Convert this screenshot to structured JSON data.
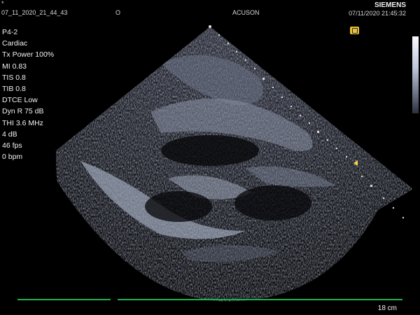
{
  "header": {
    "asterisk": "*",
    "exam_id": "07_11_2020_21_44_43",
    "orientation_marker": "O",
    "manufacturer": "ACUSON",
    "brand": "SIEMENS",
    "datetime": "07/11/2020 21:45:32"
  },
  "params": {
    "probe": "P4-2",
    "preset": "Cardiac",
    "tx_power": "Tx Power 100%",
    "mi": "MI 0.83",
    "tis": "TIS 0.8",
    "tib": "TIB 0.8",
    "dtce": "DTCE Low",
    "dyn_range": "Dyn R 75 dB",
    "thi": "THI 3.6 MHz",
    "gain": "4 dB",
    "frame_rate": "46 fps",
    "heart_rate": "0 bpm"
  },
  "footer": {
    "depth": "18 cm"
  },
  "colors": {
    "focus_marker": "#ffd24a",
    "timeline_line": "#1fb24f",
    "mode_icon": "#e8c23a"
  },
  "icons": {
    "mode_icon": "mode-indicator-icon",
    "focus_marker": "focus-arrow-icon"
  }
}
